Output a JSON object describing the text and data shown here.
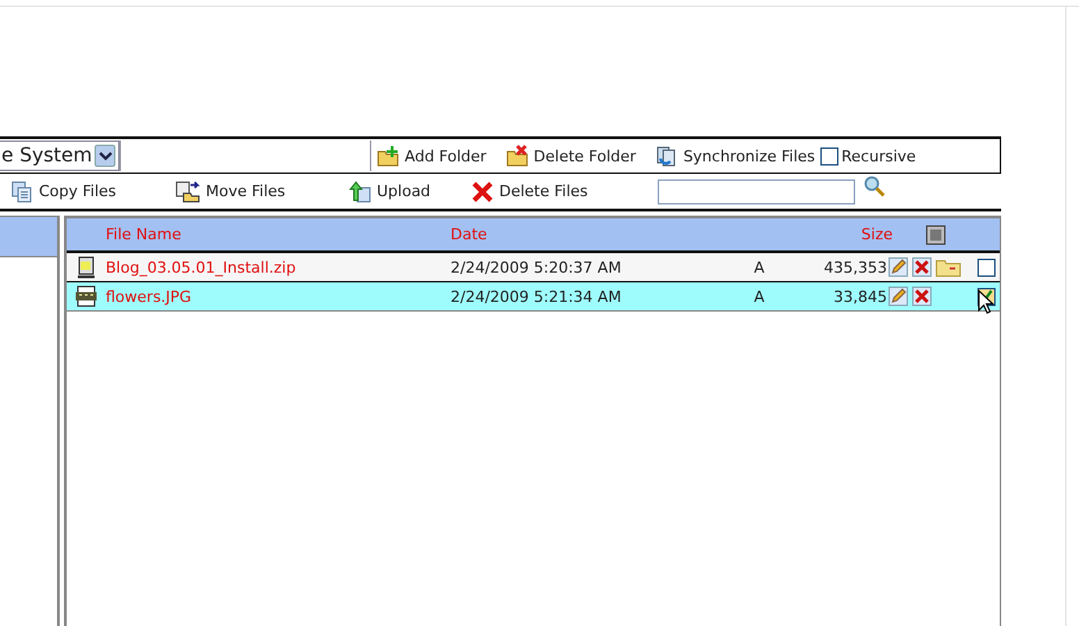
{
  "toolbar": {
    "drive_select": {
      "value": "e System"
    },
    "buttons": [
      {
        "kind": "add-folder",
        "label": "Add Folder"
      },
      {
        "kind": "delete-folder",
        "label": "Delete Folder"
      },
      {
        "kind": "sync",
        "label": "Synchronize Files"
      }
    ],
    "recursive": {
      "label": "Recursive",
      "checked": false
    }
  },
  "actions": {
    "buttons": [
      {
        "kind": "copy",
        "label": "Copy Files"
      },
      {
        "kind": "move",
        "label": "Move Files"
      },
      {
        "kind": "upload",
        "label": "Upload"
      },
      {
        "kind": "delete",
        "label": "Delete Files"
      }
    ]
  },
  "grid": {
    "columns": [
      "File Name",
      "Date",
      "Size"
    ],
    "rows": [
      {
        "kind": "zip",
        "name": "Blog_03.05.01_Install.zip",
        "date": "2/24/2009 5:20:37 AM",
        "attr": "A",
        "size": "435,353",
        "extractable": true,
        "checked": false,
        "selected": false
      },
      {
        "kind": "jpg",
        "name": "flowers.JPG",
        "date": "2/24/2009 5:21:34 AM",
        "attr": "A",
        "size": "33,845",
        "extractable": false,
        "checked": true,
        "selected": true
      }
    ]
  }
}
